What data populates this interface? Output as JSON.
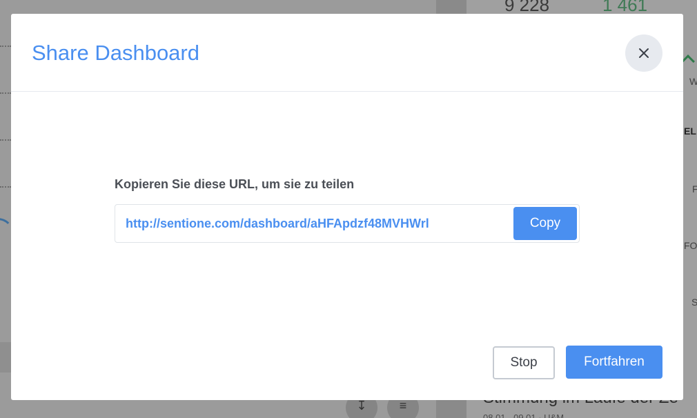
{
  "background": {
    "numbers": [
      "9 228",
      "1 461"
    ],
    "side_labels": [
      "W",
      "EL",
      "F",
      "FO",
      "S"
    ],
    "heading": "Stimmung im Laufe der Ze",
    "subheading": "08.01 - 09.01 · U&M"
  },
  "modal": {
    "title": "Share Dashboard",
    "copy_label": "Kopieren Sie diese URL, um sie zu teilen",
    "url": "http://sentione.com/dashboard/aHFApdzf48MVHWrl",
    "copy_button": "Copy",
    "stop_button": "Stop",
    "continue_button": "Fortfahren"
  },
  "colors": {
    "accent": "#4a8ff0",
    "overlay": "#9b9b9b",
    "close_bg": "#e7eaef"
  },
  "icons": {
    "close": "close-icon",
    "download": "download-icon",
    "filter": "filter-icon"
  }
}
